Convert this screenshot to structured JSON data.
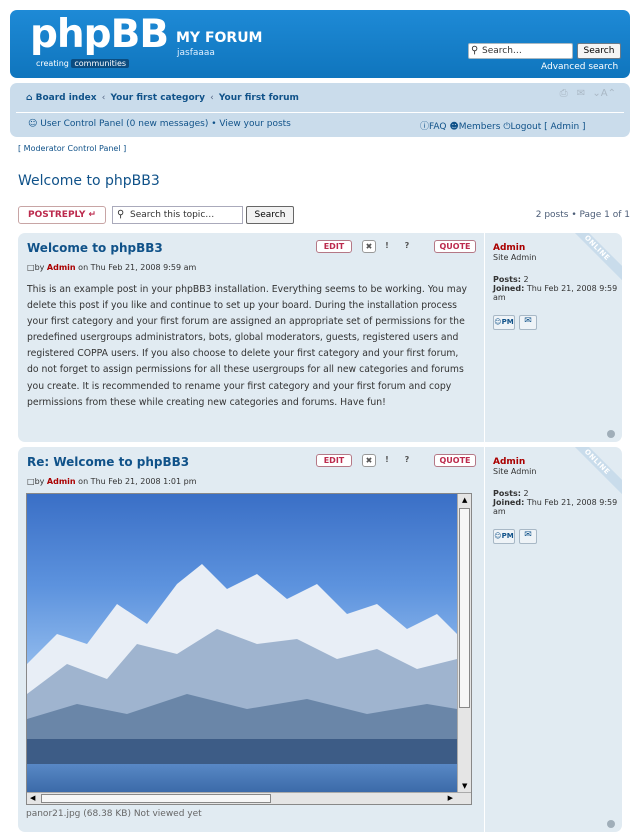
{
  "header": {
    "logo_text": "phpBB",
    "logo_tagline_a": "creating",
    "logo_tagline_b": "communities",
    "site_title": "MY FORUM",
    "site_description": "jasfaaaa",
    "search_placeholder": "Search…",
    "search_button": "Search",
    "advanced_search": "Advanced search"
  },
  "navbar": {
    "breadcrumbs": [
      "Board index",
      "Your first category",
      "Your first forum"
    ],
    "ucp": "User Control Panel (0 new messages)",
    "view_posts": "View your posts",
    "faq": "FAQ",
    "members": "Members",
    "logout": "Logout [ Admin ]",
    "font_size": "A"
  },
  "moderator_cp": "[ Moderator Control Panel ]",
  "topic_title": "Welcome to phpBB3",
  "actions": {
    "post_reply": "POSTREPLY",
    "search_placeholder": "Search this topic…",
    "search_button": "Search",
    "pagination": "2 posts • Page 1 of 1"
  },
  "post_buttons": {
    "edit": "EDIT",
    "quote": "QUOTE"
  },
  "posts": [
    {
      "title": "Welcome to phpBB3",
      "by_prefix": "by",
      "author": "Admin",
      "date": "on Thu Feb 21, 2008 9:59 am",
      "content": "This is an example post in your phpBB3 installation. Everything seems to be working. You may delete this post if you like and continue to set up your board. During the installation process your first category and your first forum are assigned an appropriate set of permissions for the predefined usergroups administrators, bots, global moderators, guests, registered users and registered COPPA users. If you also choose to delete your first category and your first forum, do not forget to assign permissions for all these usergroups for all new categories and forums you create. It is recommended to rename your first category and your first forum and copy permissions from these while creating new categories and forums. Have fun!",
      "profile": {
        "username": "Admin",
        "rank": "Site Admin",
        "posts_label": "Posts:",
        "posts": "2",
        "joined_label": "Joined:",
        "joined": "Thu Feb 21, 2008 9:59 am"
      },
      "online": "ONLINE"
    },
    {
      "title": "Re: Welcome to phpBB3",
      "by_prefix": "by",
      "author": "Admin",
      "date": "on Thu Feb 21, 2008 1:01 pm",
      "attachment_caption": "panor21.jpg (68.38 KB) Not viewed yet",
      "profile": {
        "username": "Admin",
        "rank": "Site Admin",
        "posts_label": "Posts:",
        "posts": "2",
        "joined_label": "Joined:",
        "joined": "Thu Feb 21, 2008 9:59 am"
      },
      "online": "ONLINE"
    }
  ],
  "pm_label": "PM",
  "colors": {
    "brand_blue": "#0f75bd",
    "link": "#105289",
    "admin": "#aa0000",
    "post_bg": "#e1ebf2"
  }
}
